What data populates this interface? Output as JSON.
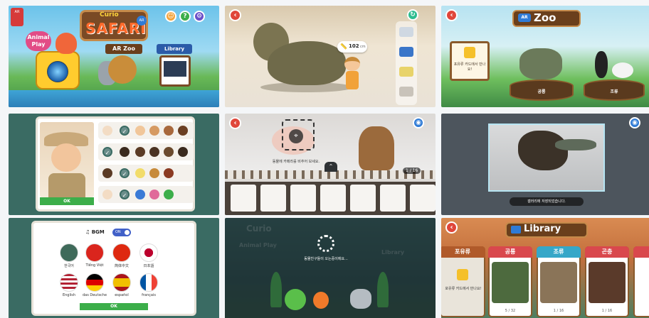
{
  "home": {
    "logo_text": "AR",
    "brand_small": "Curio",
    "brand_large": "SAFARI",
    "ar_badge": "AR",
    "animal_play": "Animal Play",
    "ar_zoo": "AR Zoo",
    "library": "Library",
    "hud": [
      "?",
      "⚙"
    ]
  },
  "ar_view": {
    "measure_value": "102",
    "measure_unit": "cm"
  },
  "zoo": {
    "ar_tag": "AR",
    "title": "Zoo",
    "locked_text": "포유류 카드에서 만나요!",
    "pedestals": [
      "공룡",
      "조류"
    ]
  },
  "avatar": {
    "ok_label": "OK"
  },
  "scan": {
    "hint": "동물에 카메라를 비추어 보세요.",
    "counter": "1 / 16"
  },
  "gallery": {
    "toast": "갤러리에 저장되었습니다."
  },
  "settings": {
    "bgm_label": "BGM",
    "toggle_label": "ON",
    "languages": [
      "한국어",
      "Tiếng Việt",
      "简体中文",
      "日本語",
      "English",
      "das Deutsche",
      "español",
      "français"
    ],
    "ok_label": "OK"
  },
  "loading": {
    "text": "동물친구들이 오는중이에요...",
    "faded_logo": "Curio",
    "faded_play": "Animal Play",
    "faded_library": "Library"
  },
  "library": {
    "title": "Library",
    "cards": [
      {
        "label": "포유류",
        "count": "",
        "color": "#b05a2a"
      },
      {
        "label": "공룡",
        "count": "5 / 32",
        "color": "#d9484d"
      },
      {
        "label": "조류",
        "count": "1 / 16",
        "color": "#36a7c8"
      },
      {
        "label": "곤충",
        "count": "1 / 16",
        "color": "#d9484d"
      }
    ],
    "locked_text": "포유류 카드에서 만나요!"
  },
  "colors": {
    "back": "#e0463a",
    "accent_blue": "#2f7bd6",
    "ok_green": "#3cae4a"
  }
}
